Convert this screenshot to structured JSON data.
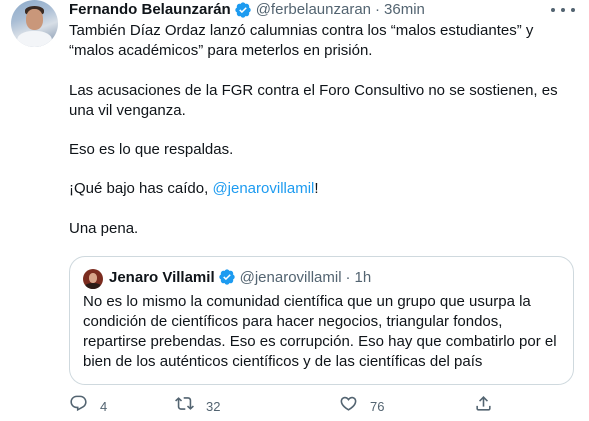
{
  "author": {
    "name": "Fernando Belaunzarán",
    "handle": "@ferbelaunzaran",
    "separator": "·",
    "time": "36min"
  },
  "tweet": {
    "paragraph_1": "También Díaz Ordaz lanzó calumnias contra los “malos estudiantes” y “malos académicos” para meterlos en prisión.",
    "paragraph_2": "Las acusaciones de la FGR contra el Foro Consultivo no se sostienen, es una vil venganza.",
    "paragraph_3": "Eso es lo que respaldas.",
    "paragraph_4_prefix": "¡Qué bajo has caído, ",
    "paragraph_4_mention": "@jenarovillamil",
    "paragraph_4_suffix": "!",
    "paragraph_5": "Una pena."
  },
  "quoted_tweet": {
    "name": "Jenaro Villamil",
    "handle": "@jenarovillamil",
    "separator": "·",
    "time": "1h",
    "text": "No es lo mismo la comunidad científica que un grupo que usurpa la condición de científicos para hacer negocios, triangular fondos, repartirse prebendas. Eso es corrupción. Eso hay que combatirlo por el bien de los auténticos científicos y de las científicas del país"
  },
  "actions": {
    "reply_count": "4",
    "retweet_count": "32",
    "like_count": "76",
    "share_count": ""
  },
  "icons": {
    "verified": "verified-badge-icon",
    "more": "more-options-icon",
    "reply": "reply-icon",
    "retweet": "retweet-icon",
    "like": "heart-icon",
    "share": "share-icon"
  },
  "colors": {
    "text": "#0f1419",
    "secondary": "#536471",
    "accent": "#1d9bf0",
    "border": "#cfd9de"
  }
}
